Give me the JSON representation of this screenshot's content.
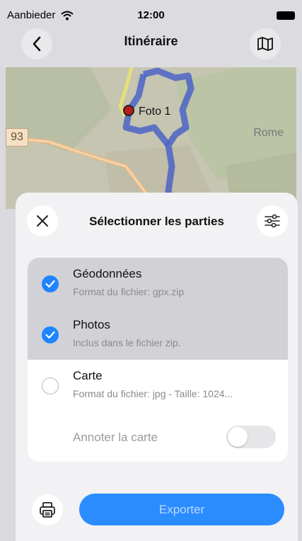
{
  "status_bar": {
    "carrier": "Aanbieder",
    "time": "12:00"
  },
  "nav": {
    "title": "Itinéraire",
    "back_icon": "chevron-left-icon",
    "map_icon": "map-icon"
  },
  "map": {
    "road_number": "93",
    "photo_label": "Foto 1",
    "city_fragment": "Rome",
    "route_color": "#4b63c7",
    "marker_color": "#b71c1c"
  },
  "sheet": {
    "title": "Sélectionner les parties",
    "items": [
      {
        "title": "Géodonnées",
        "subtitle": "Format du fichier: gpx.zip",
        "checked": true
      },
      {
        "title": "Photos",
        "subtitle": "Inclus dans le fichier zip.",
        "checked": true
      },
      {
        "title": "Carte",
        "subtitle": "Format du fichier: jpg - Taille: 1024...",
        "checked": false
      }
    ],
    "annotate_label": "Annoter la carte",
    "annotate_enabled": false,
    "export_label": "Exporter"
  },
  "colors": {
    "accent": "#1e84ff",
    "export_button": "#2a8cff",
    "selected_row": "#d1d1d6"
  }
}
